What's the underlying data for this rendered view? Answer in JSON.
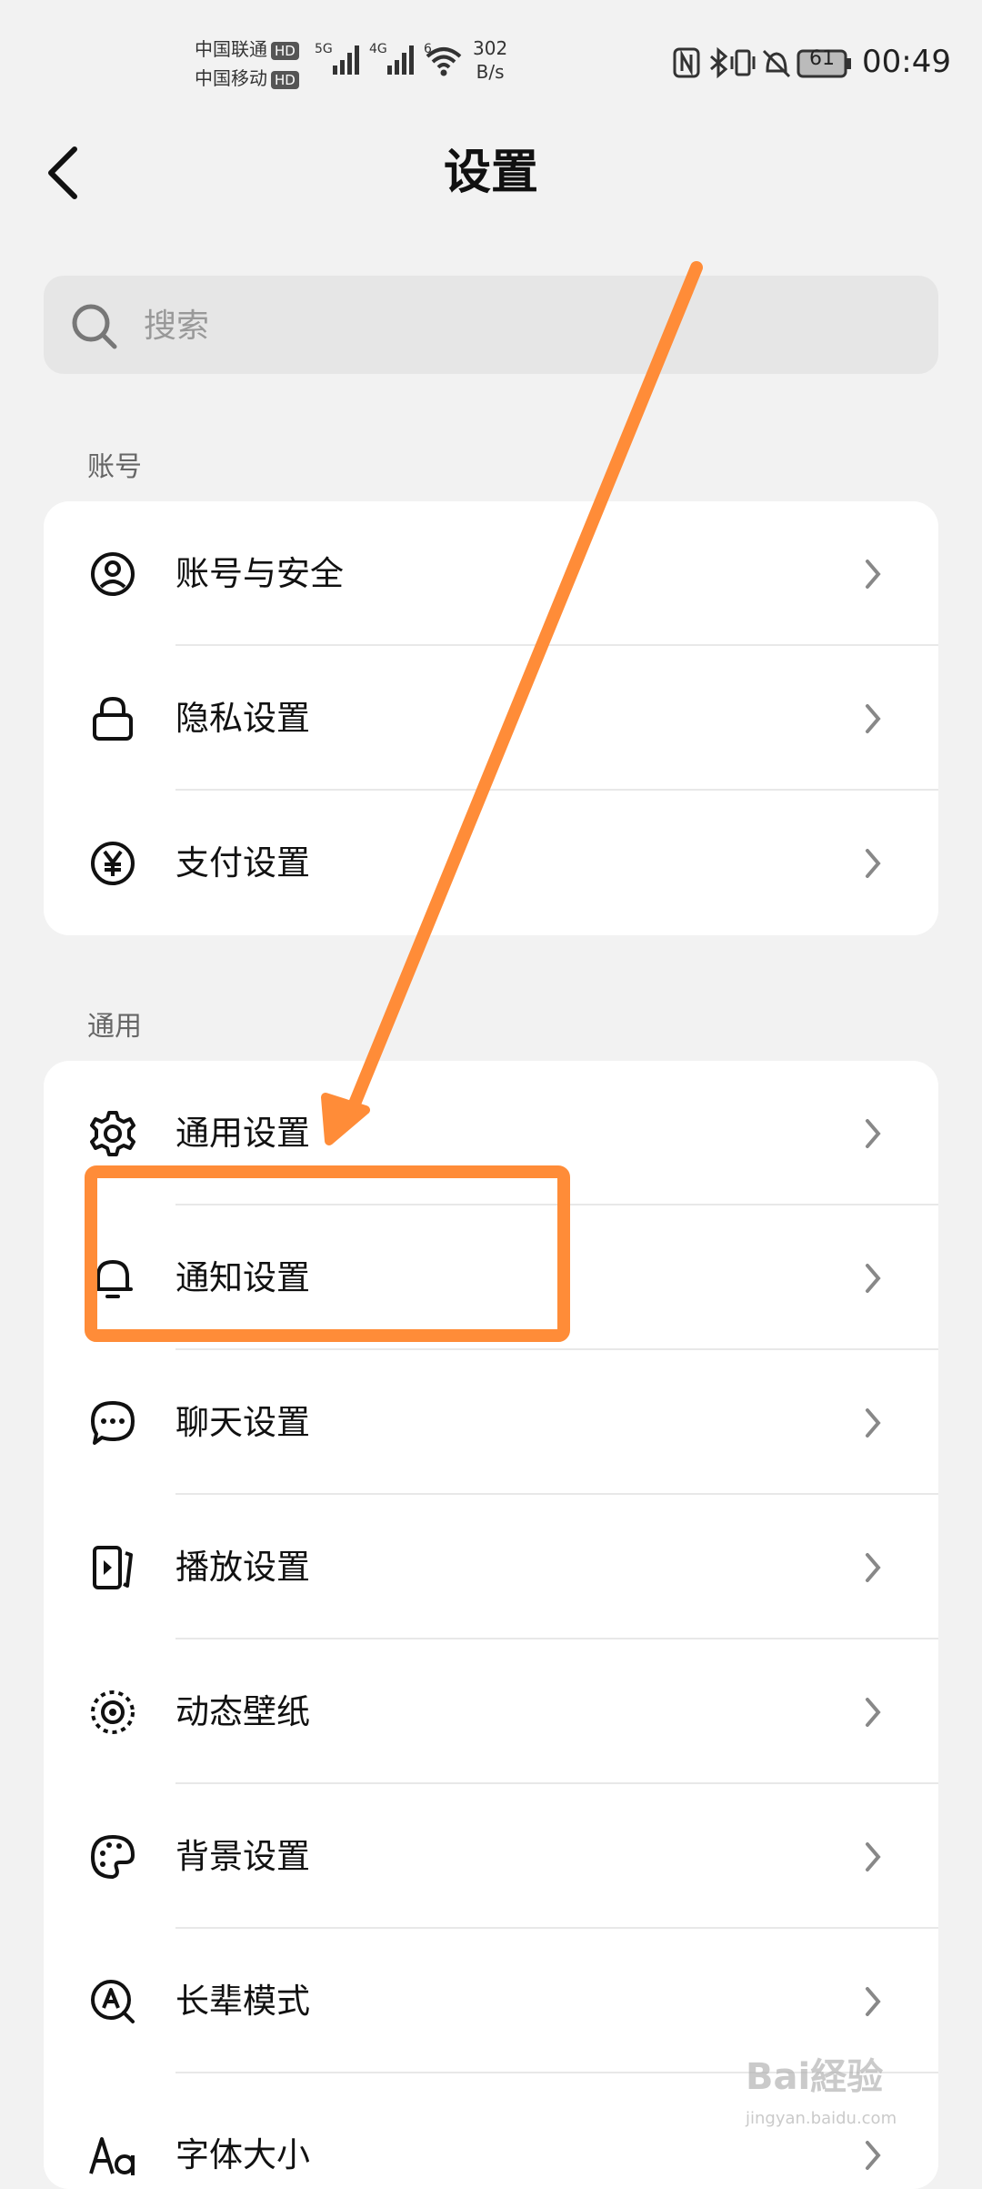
{
  "status_bar": {
    "carrier1": "中国联通",
    "carrier2": "中国移动",
    "hd": "HD",
    "net1": "5G",
    "net2": "4G",
    "wifi_gen": "6",
    "speed_value": "302",
    "speed_unit": "B/s",
    "battery": "61",
    "time": "00:49"
  },
  "header": {
    "title": "设置"
  },
  "search": {
    "placeholder": "搜索"
  },
  "sections": {
    "account": {
      "label": "账号",
      "items": [
        {
          "label": "账号与安全",
          "icon": "user-circle-icon"
        },
        {
          "label": "隐私设置",
          "icon": "lock-icon"
        },
        {
          "label": "支付设置",
          "icon": "yen-icon"
        }
      ]
    },
    "general": {
      "label": "通用",
      "items": [
        {
          "label": "通用设置",
          "icon": "gear-icon"
        },
        {
          "label": "通知设置",
          "icon": "bell-icon"
        },
        {
          "label": "聊天设置",
          "icon": "chat-bubble-icon"
        },
        {
          "label": "播放设置",
          "icon": "play-screen-icon"
        },
        {
          "label": "动态壁纸",
          "icon": "dynamic-wallpaper-icon"
        },
        {
          "label": "背景设置",
          "icon": "palette-icon"
        },
        {
          "label": "长辈模式",
          "icon": "elder-mode-icon"
        },
        {
          "label": "字体大小",
          "icon": "font-size-icon"
        }
      ]
    }
  },
  "watermark": {
    "text": "Bai経验",
    "sub": "jingyan.baidu.com"
  },
  "colors": {
    "annotation": "#ff8c38",
    "background": "#f2f2f2",
    "card": "#ffffff"
  }
}
